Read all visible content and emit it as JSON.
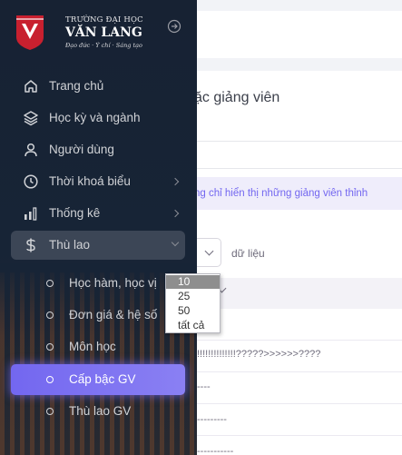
{
  "brand": {
    "line1": "TRƯỜNG ĐẠI HỌC",
    "line2": "VĂN LANG",
    "line3": "Đạo đức · Ý chí · Sáng tạo"
  },
  "sidebar": {
    "items": [
      {
        "label": "Trang chủ",
        "icon": "home-icon"
      },
      {
        "label": "Học kỳ và ngành",
        "icon": "layers-icon"
      },
      {
        "label": "Người dùng",
        "icon": "user-icon"
      },
      {
        "label": "Thời khoá biểu",
        "icon": "clock-icon",
        "has_children": true
      },
      {
        "label": "Thống kê",
        "icon": "bar-chart-icon",
        "has_children": true
      },
      {
        "label": "Thù lao",
        "icon": "dollar-icon",
        "has_children": true,
        "expanded": true
      }
    ],
    "sub_items": [
      {
        "label": "Học hàm, học vị"
      },
      {
        "label": "Đơn giá & hệ số"
      },
      {
        "label": "Môn học"
      },
      {
        "label": "Cấp bậc GV",
        "active": true
      },
      {
        "label": "Thù lao GV"
      }
    ]
  },
  "main": {
    "page_title": "ặc giảng viên",
    "notice": "ng chỉ hiển thị những giảng viên thỉnh",
    "entries_suffix": "dữ liệu",
    "rows": [
      "!!!!!!!!!!!!!!?????>>>>>>????",
      "----",
      "---------",
      "-----------"
    ]
  },
  "page_size": {
    "options": [
      "10",
      "25",
      "50",
      "tất cả"
    ],
    "selected": "10"
  },
  "colors": {
    "accent": "#7367f0",
    "sidebar_bg": "#172436",
    "brand_red": "#c8202f"
  }
}
